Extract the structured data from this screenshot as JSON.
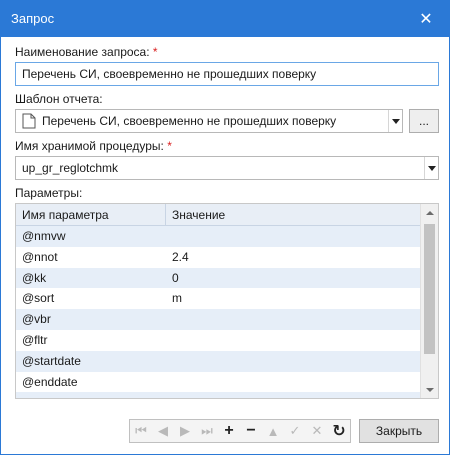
{
  "window": {
    "title": "Запрос"
  },
  "form": {
    "name_label": "Наименование запроса:",
    "name_required": "*",
    "name_value": "Перечень СИ, своевременно не прошедших поверку",
    "template_label": "Шаблон отчета:",
    "template_value": "Перечень СИ, своевременно не прошедших поверку",
    "template_button": "...",
    "procedure_label": "Имя хранимой процедуры:",
    "procedure_required": "*",
    "procedure_value": "up_gr_reglotchmk",
    "params_label": "Параметры:"
  },
  "grid": {
    "columns": [
      "Имя параметра",
      "Значение"
    ],
    "rows": [
      [
        "@nmvw",
        ""
      ],
      [
        "@nnot",
        "2.4"
      ],
      [
        "@kk",
        "0"
      ],
      [
        "@sort",
        "m"
      ],
      [
        "@vbr",
        ""
      ],
      [
        "@fltr",
        ""
      ],
      [
        "@startdate",
        ""
      ],
      [
        "@enddate",
        ""
      ]
    ]
  },
  "navigator": {
    "first": "⏮",
    "prev_page": "◀",
    "next_page": "▶",
    "last": "⏭",
    "add": "+",
    "remove": "−",
    "up": "▲",
    "confirm": "✓",
    "cancel": "✕",
    "refresh": "↻"
  },
  "buttons": {
    "close_label": "Закрыть"
  },
  "icons": {
    "close": "close-icon",
    "document": "document-icon"
  },
  "colors": {
    "titlebar": "#2b79d6",
    "required": "#d92020",
    "grid_header": "#e8eef6",
    "row_alt": "#e6eef8"
  }
}
